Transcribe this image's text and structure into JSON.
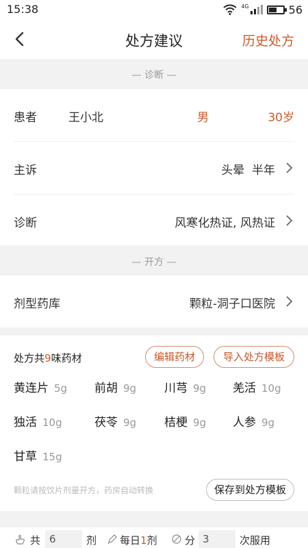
{
  "status": {
    "time": "15:38",
    "battery": "56",
    "network": "4G",
    "battery_level": 0.56
  },
  "nav": {
    "title": "处方建议",
    "history_label": "历史处方"
  },
  "diagnosis_section": {
    "header": "— 诊断 —",
    "patient_label": "患者",
    "patient_name": "王小北",
    "patient_gender": "男",
    "patient_age": "30岁",
    "complaint_label": "主诉",
    "complaint_value": "头晕  半年",
    "diagnosis_label": "诊断",
    "diagnosis_value": "风寒化热证, 风热证"
  },
  "prescribe_section": {
    "header": "— 开方 —",
    "pharmacy_label": "剂型药库",
    "pharmacy_value": "颗粒-洞子口医院"
  },
  "prescription": {
    "count_prefix": "处方共",
    "count_num": "9",
    "count_suffix": "味药材",
    "edit_label": "编辑药材",
    "import_label": "导入处方模板",
    "herbs": [
      {
        "name": "黄连片",
        "dose": "5g"
      },
      {
        "name": "前胡",
        "dose": "9g"
      },
      {
        "name": "川芎",
        "dose": "9g"
      },
      {
        "name": "羌活",
        "dose": "10g"
      },
      {
        "name": "独活",
        "dose": "10g"
      },
      {
        "name": "茯苓",
        "dose": "9g"
      },
      {
        "name": "桔梗",
        "dose": "9g"
      },
      {
        "name": "人参",
        "dose": "9g"
      },
      {
        "name": "甘草",
        "dose": "15g"
      }
    ],
    "note": "颗粒请按饮片剂量开方，药房自动转换",
    "save_template_label": "保存到处方模板"
  },
  "bottom": {
    "total_prefix": "共",
    "total_value": "6",
    "total_suffix": "剂",
    "daily_prefix": "每日",
    "daily_num": "1",
    "daily_suffix": "剂",
    "split_prefix": "分",
    "split_value": "3",
    "split_suffix": "次服用"
  }
}
